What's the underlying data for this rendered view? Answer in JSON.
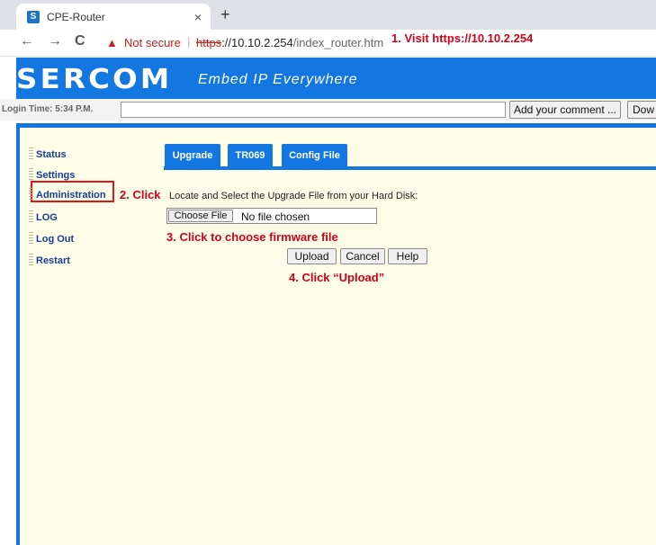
{
  "browser": {
    "tab_title": "CPE-Router",
    "tab_close": "×",
    "new_tab": "+",
    "back": "←",
    "forward": "→",
    "reload": "C",
    "warning_icon": "▲",
    "not_secure": "Not secure",
    "separator": "|",
    "url_scheme": "https",
    "url_rest_host": "://10.10.2.254",
    "url_path": "/index_router.htm"
  },
  "annotations": {
    "step1": "1. Visit https://10.10.2.254",
    "step2": "2. Click",
    "step3": "3. Click to choose firmware file",
    "step4": "4. Click “Upload”"
  },
  "header": {
    "logo": "SERCOM",
    "tagline": "Embed IP Everywhere"
  },
  "login_bar": {
    "label": "Login Time: 5:34 P.M.",
    "field_value": "",
    "add_comment_label": "Add your comment ...",
    "download_label": "Dow"
  },
  "sidebar": {
    "items": [
      "Status",
      "Settings",
      "Administration",
      "LOG",
      "Log Out",
      "Restart"
    ],
    "selected": "Administration"
  },
  "main": {
    "tabs": [
      "Upgrade",
      "TR069",
      "Config File"
    ],
    "instruction": "Locate and Select the Upgrade File from your Hard Disk:",
    "choose_file_label": "Choose File",
    "file_status": "No file chosen",
    "upload_label": "Upload",
    "cancel_label": "Cancel",
    "help_label": "Help"
  },
  "colors": {
    "brand_blue": "#1277e1",
    "annotation_red": "#d0021b",
    "panel_bg": "#fdfde8"
  }
}
